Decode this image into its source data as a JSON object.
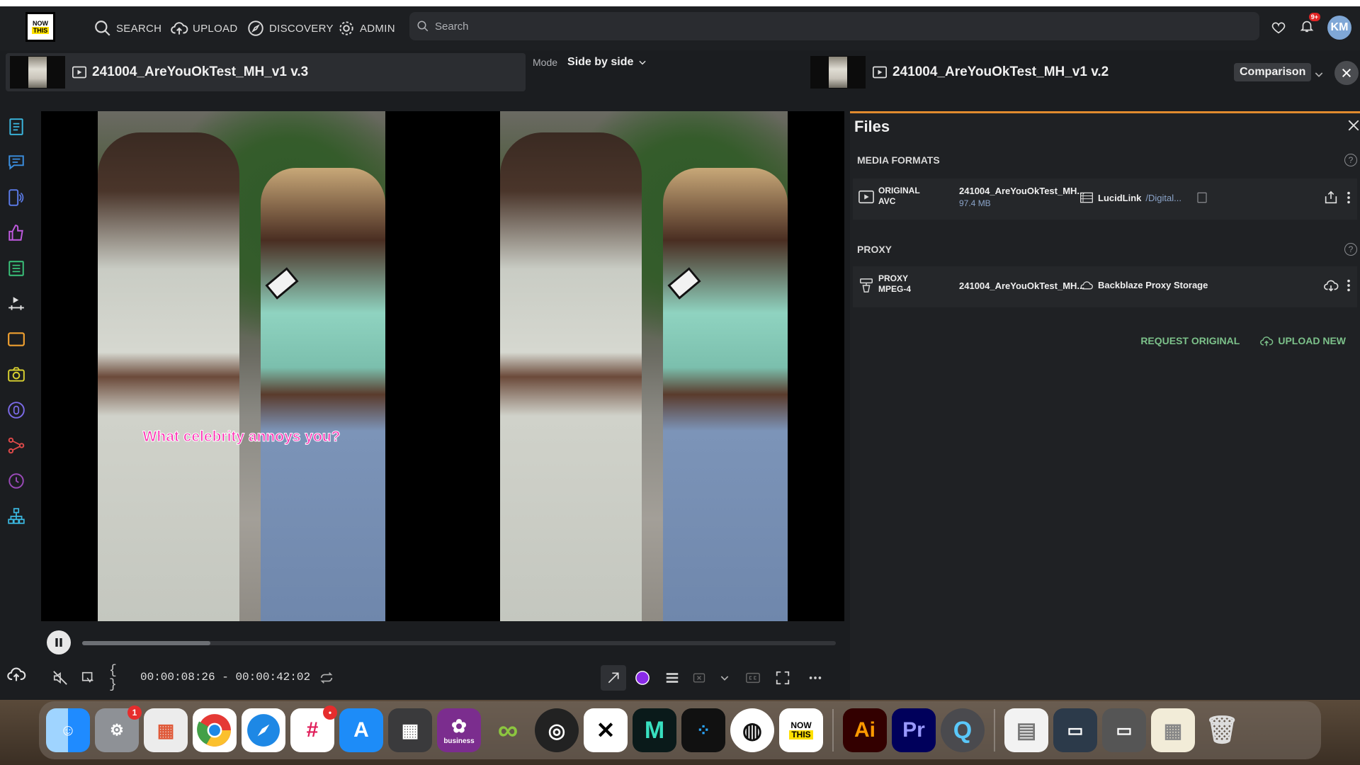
{
  "app": {
    "logo_line1": "NOW",
    "logo_line2": "THIS"
  },
  "nav": {
    "search": "SEARCH",
    "upload": "UPLOAD",
    "discovery": "DISCOVERY",
    "admin": "ADMIN"
  },
  "search": {
    "placeholder": "Search"
  },
  "notifications": {
    "badge": "9+"
  },
  "user": {
    "initials": "KM"
  },
  "compare": {
    "left_title": "241004_AreYouOkTest_MH_v1 v.3",
    "mode_label": "Mode",
    "mode_value": "Side by side",
    "right_title": "241004_AreYouOkTest_MH_v1 v.2",
    "comparison_label": "Comparison"
  },
  "player": {
    "caption": "What celebrity annoys you?",
    "timecode_in": "00:00:08:26",
    "timecode_sep": "-",
    "timecode_out": "00:00:42:02",
    "progress": 0.17
  },
  "files": {
    "title": "Files",
    "media_formats_label": "MEDIA FORMATS",
    "proxy_label": "PROXY",
    "original": {
      "type": "ORIGINAL",
      "codec": "AVC",
      "filename": "241004_AreYouOkTest_MH...",
      "size": "97.4 MB",
      "storage": "LucidLink",
      "storage_sub": "/Digital..."
    },
    "proxy": {
      "type": "PROXY",
      "codec": "MPEG-4",
      "filename": "241004_AreYouOkTest_MH...",
      "storage": "Backblaze Proxy Storage"
    },
    "request_original": "REQUEST ORIGINAL",
    "upload_new": "UPLOAD NEW"
  },
  "dock": {
    "system_settings_badge": "1",
    "slack_badge": "•",
    "business_label": "business",
    "nowthis_line1": "NOW",
    "nowthis_line2": "THIS",
    "ai": "Ai",
    "pr": "Pr"
  },
  "colors": {
    "accent": "#e08a2e",
    "link_green": "#7cc18a",
    "caption_pink": "#ff2fb4",
    "badge_red": "#e02424"
  }
}
